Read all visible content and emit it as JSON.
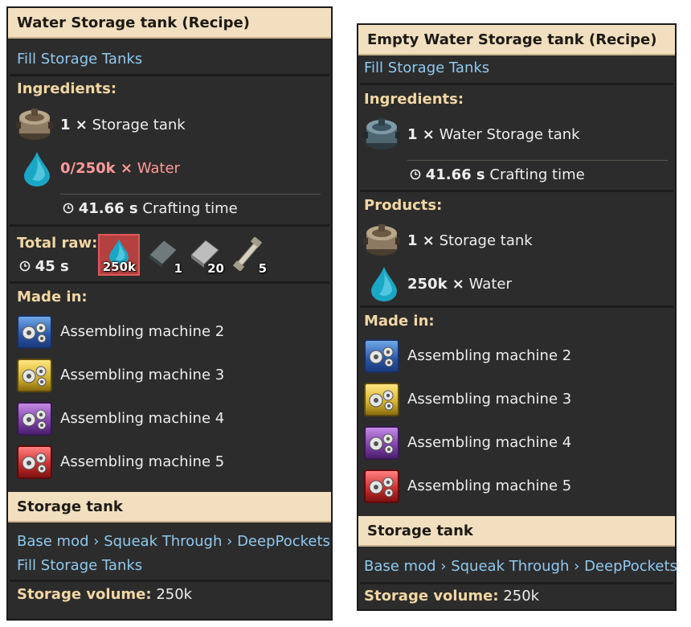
{
  "left": {
    "header": "Water Storage tank (Recipe)",
    "category_link": "Fill Storage Tanks",
    "ingredients_title": "Ingredients:",
    "ingredients": [
      {
        "amount": "1 ×",
        "name": "Storage tank",
        "icon": "storage-tank-icon"
      },
      {
        "amount": "0/250k ×",
        "name": "Water",
        "icon": "water-drop-icon",
        "status_color": "#ff9a9a"
      }
    ],
    "crafting_time": {
      "value": "41.66 s",
      "label": "Crafting time"
    },
    "total_raw": {
      "title": "Total raw:",
      "time": "45 s",
      "items": [
        {
          "icon": "water-icon",
          "count": "250k",
          "highlighted": true
        },
        {
          "icon": "dark-plate-icon",
          "count": "1"
        },
        {
          "icon": "steel-plate-icon",
          "count": "20"
        },
        {
          "icon": "pipe-icon",
          "count": "5"
        }
      ]
    },
    "made_in_title": "Made in:",
    "made_in": [
      {
        "name": "Assembling machine 2",
        "color": "#2957a8"
      },
      {
        "name": "Assembling machine 3",
        "color": "#d2b12a"
      },
      {
        "name": "Assembling machine 4",
        "color": "#7d3fa8"
      },
      {
        "name": "Assembling machine 5",
        "color": "#c82a2a"
      }
    ],
    "item_header": "Storage tank",
    "mod_path": [
      "Base mod",
      "Squeak Through",
      "DeepPockets"
    ],
    "mod_separator": "›",
    "item_category_link": "Fill Storage Tanks",
    "storage_volume_label": "Storage volume:",
    "storage_volume_value": "250k"
  },
  "right": {
    "header": "Empty Water Storage tank (Recipe)",
    "category_link": "Fill Storage Tanks",
    "ingredients_title": "Ingredients:",
    "ingredients": [
      {
        "amount": "1 ×",
        "name": "Water Storage tank",
        "icon": "water-storage-tank-icon"
      }
    ],
    "crafting_time": {
      "value": "41.66 s",
      "label": "Crafting time"
    },
    "products_title": "Products:",
    "products": [
      {
        "amount": "1 ×",
        "name": "Storage tank",
        "icon": "storage-tank-icon"
      },
      {
        "amount": "250k ×",
        "name": "Water",
        "icon": "water-drop-icon"
      }
    ],
    "made_in_title": "Made in:",
    "made_in": [
      {
        "name": "Assembling machine 2",
        "color": "#2957a8"
      },
      {
        "name": "Assembling machine 3",
        "color": "#d2b12a"
      },
      {
        "name": "Assembling machine 4",
        "color": "#7d3fa8"
      },
      {
        "name": "Assembling machine 5",
        "color": "#c82a2a"
      }
    ],
    "item_header": "Storage tank",
    "mod_path": [
      "Base mod",
      "Squeak Through",
      "DeepPockets"
    ],
    "mod_separator": "›",
    "storage_volume_label": "Storage volume:",
    "storage_volume_value": "250k"
  }
}
